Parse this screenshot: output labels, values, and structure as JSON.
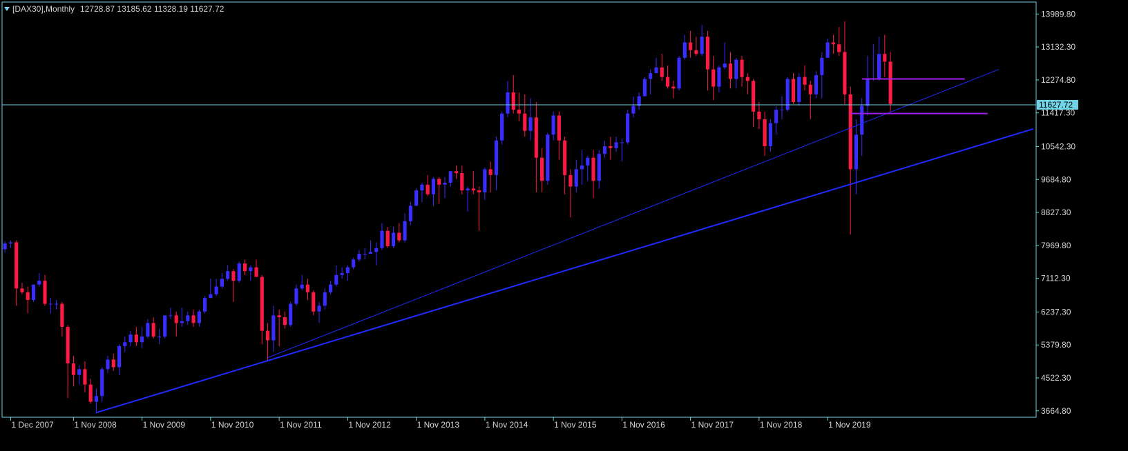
{
  "header": {
    "symbol": "[DAX30],Monthly",
    "ohlc": "12728.87 13185.62 11328.19 11627.72"
  },
  "colors": {
    "background": "#000000",
    "frame": "#6fd3e6",
    "bull": "#3a2dff",
    "bear": "#ff1a45",
    "bid_line": "#6fd3e6",
    "trendline": "#1f2bff",
    "level_line": "#a020f0",
    "axis_text": "#d8d8d8"
  },
  "chart_data": {
    "type": "candlestick",
    "timeframe": "Monthly",
    "symbol": "[DAX30]",
    "last_price": 11627.72,
    "last_price_label": "11627.72",
    "y_ticks": [
      "13989.80",
      "13132.30",
      "12274.80",
      "11417.30",
      "10542.30",
      "9684.80",
      "8827.30",
      "7969.80",
      "7112.30",
      "6237.30",
      "5379.80",
      "4522.30",
      "3664.80"
    ],
    "x_ticks": [
      "1 Dec 2007",
      "1 Nov 2008",
      "1 Nov 2009",
      "1 Nov 2010",
      "1 Nov 2011",
      "1 Nov 2012",
      "1 Nov 2013",
      "1 Nov 2014",
      "1 Nov 2015",
      "1 Nov 2016",
      "1 Nov 2017",
      "1 Nov 2018",
      "1 Nov 2019"
    ],
    "y_range": [
      3500,
      14300
    ],
    "x_start": "2007-11",
    "x_end": "2022-11",
    "candles": [
      [
        "2007-11",
        7870,
        8080,
        7780,
        8020
      ],
      [
        "2007-12",
        8020,
        8100,
        7900,
        8050
      ],
      [
        "2008-01",
        8050,
        8100,
        6400,
        6850
      ],
      [
        "2008-02",
        6850,
        7000,
        6700,
        6750
      ],
      [
        "2008-03",
        6750,
        6900,
        6200,
        6550
      ],
      [
        "2008-04",
        6550,
        6950,
        6500,
        6950
      ],
      [
        "2008-05",
        6950,
        7250,
        6900,
        7050
      ],
      [
        "2008-06",
        7050,
        7200,
        6400,
        6450
      ],
      [
        "2008-07",
        6450,
        6600,
        6200,
        6450
      ],
      [
        "2008-08",
        6450,
        6550,
        6300,
        6450
      ],
      [
        "2008-09",
        6450,
        6500,
        5600,
        5850
      ],
      [
        "2008-10",
        5850,
        5900,
        4000,
        4900
      ],
      [
        "2008-11",
        4900,
        5100,
        4300,
        4600
      ],
      [
        "2008-12",
        4600,
        4850,
        4350,
        4750
      ],
      [
        "2009-01",
        4750,
        4950,
        4150,
        4350
      ],
      [
        "2009-02",
        4350,
        4500,
        3850,
        3900
      ],
      [
        "2009-03",
        3900,
        4250,
        3600,
        4050
      ],
      [
        "2009-04",
        4050,
        4800,
        3900,
        4750
      ],
      [
        "2009-05",
        4750,
        5100,
        4650,
        5000
      ],
      [
        "2009-06",
        5000,
        5150,
        4700,
        4800
      ],
      [
        "2009-07",
        4800,
        5400,
        4600,
        5350
      ],
      [
        "2009-08",
        5350,
        5600,
        5200,
        5450
      ],
      [
        "2009-09",
        5450,
        5750,
        5350,
        5650
      ],
      [
        "2009-10",
        5650,
        5850,
        5350,
        5450
      ],
      [
        "2009-11",
        5450,
        5850,
        5300,
        5600
      ],
      [
        "2009-12",
        5600,
        6050,
        5550,
        5950
      ],
      [
        "2010-01",
        5950,
        6100,
        5550,
        5600
      ],
      [
        "2010-02",
        5600,
        5800,
        5400,
        5600
      ],
      [
        "2010-03",
        5600,
        6150,
        5550,
        6150
      ],
      [
        "2010-04",
        6150,
        6350,
        6050,
        6150
      ],
      [
        "2010-05",
        6150,
        6250,
        5600,
        5950
      ],
      [
        "2010-06",
        5950,
        6350,
        5850,
        6000
      ],
      [
        "2010-07",
        6000,
        6250,
        5900,
        6150
      ],
      [
        "2010-08",
        6150,
        6300,
        5850,
        5950
      ],
      [
        "2010-09",
        5950,
        6300,
        5850,
        6250
      ],
      [
        "2010-10",
        6250,
        6650,
        6200,
        6600
      ],
      [
        "2010-11",
        6600,
        7100,
        6600,
        6700
      ],
      [
        "2010-12",
        6700,
        7100,
        6650,
        6900
      ],
      [
        "2011-01",
        6900,
        7250,
        6850,
        7100
      ],
      [
        "2011-02",
        7100,
        7450,
        7050,
        7300
      ],
      [
        "2011-03",
        7300,
        7350,
        6500,
        7050
      ],
      [
        "2011-04",
        7050,
        7550,
        7000,
        7500
      ],
      [
        "2011-05",
        7500,
        7600,
        7200,
        7300
      ],
      [
        "2011-06",
        7300,
        7450,
        7050,
        7400
      ],
      [
        "2011-07",
        7400,
        7600,
        7200,
        7150
      ],
      [
        "2011-08",
        7150,
        7200,
        5400,
        5750
      ],
      [
        "2011-09",
        5750,
        5950,
        4950,
        5500
      ],
      [
        "2011-10",
        5500,
        6400,
        5200,
        6150
      ],
      [
        "2011-11",
        6150,
        6300,
        5350,
        6100
      ],
      [
        "2011-12",
        6100,
        6250,
        5800,
        5900
      ],
      [
        "2012-01",
        5900,
        6500,
        5850,
        6450
      ],
      [
        "2012-02",
        6450,
        6950,
        6400,
        6850
      ],
      [
        "2012-03",
        6850,
        7200,
        6800,
        6950
      ],
      [
        "2012-04",
        6950,
        7100,
        6550,
        6750
      ],
      [
        "2012-05",
        6750,
        6800,
        6150,
        6250
      ],
      [
        "2012-06",
        6250,
        6500,
        5950,
        6400
      ],
      [
        "2012-07",
        6400,
        6850,
        6300,
        6750
      ],
      [
        "2012-08",
        6750,
        7050,
        6700,
        6950
      ],
      [
        "2012-09",
        6950,
        7450,
        6900,
        7200
      ],
      [
        "2012-10",
        7200,
        7400,
        7100,
        7250
      ],
      [
        "2012-11",
        7250,
        7450,
        7050,
        7400
      ],
      [
        "2012-12",
        7400,
        7650,
        7350,
        7600
      ],
      [
        "2013-01",
        7600,
        7850,
        7550,
        7750
      ],
      [
        "2013-02",
        7750,
        7900,
        7600,
        7750
      ],
      [
        "2013-03",
        7750,
        8100,
        7750,
        7800
      ],
      [
        "2013-04",
        7800,
        8050,
        7450,
        7900
      ],
      [
        "2013-05",
        7900,
        8550,
        7850,
        8350
      ],
      [
        "2013-06",
        8350,
        8450,
        7900,
        7950
      ],
      [
        "2013-07",
        7950,
        8450,
        7900,
        8300
      ],
      [
        "2013-08",
        8300,
        8550,
        8050,
        8100
      ],
      [
        "2013-09",
        8100,
        8800,
        8050,
        8600
      ],
      [
        "2013-10",
        8600,
        9100,
        8500,
        9000
      ],
      [
        "2013-11",
        9000,
        9450,
        9000,
        9400
      ],
      [
        "2013-12",
        9400,
        9600,
        9100,
        9550
      ],
      [
        "2014-01",
        9550,
        9800,
        9250,
        9300
      ],
      [
        "2014-02",
        9300,
        9750,
        9000,
        9700
      ],
      [
        "2014-03",
        9700,
        9750,
        9050,
        9550
      ],
      [
        "2014-04",
        9550,
        9750,
        9200,
        9600
      ],
      [
        "2014-05",
        9600,
        9900,
        9500,
        9900
      ],
      [
        "2014-06",
        9900,
        10050,
        9700,
        9850
      ],
      [
        "2014-07",
        9850,
        10050,
        9300,
        9400
      ],
      [
        "2014-08",
        9400,
        9500,
        8850,
        9450
      ],
      [
        "2014-09",
        9450,
        9900,
        9300,
        9400
      ],
      [
        "2014-10",
        9400,
        9500,
        8350,
        9350
      ],
      [
        "2014-11",
        9350,
        10000,
        9150,
        9950
      ],
      [
        "2014-12",
        9950,
        10150,
        9350,
        9800
      ],
      [
        "2015-01",
        9800,
        10800,
        9400,
        10700
      ],
      [
        "2015-02",
        10700,
        11450,
        10600,
        11400
      ],
      [
        "2015-03",
        11400,
        12250,
        11300,
        11950
      ],
      [
        "2015-04",
        11950,
        12400,
        11400,
        11500
      ],
      [
        "2015-05",
        11500,
        11950,
        11200,
        11400
      ],
      [
        "2015-06",
        11400,
        11900,
        10800,
        10950
      ],
      [
        "2015-07",
        10950,
        11800,
        10700,
        11300
      ],
      [
        "2015-08",
        11300,
        11700,
        9350,
        10250
      ],
      [
        "2015-09",
        10250,
        10500,
        9350,
        9650
      ],
      [
        "2015-10",
        9650,
        10900,
        9550,
        10850
      ],
      [
        "2015-11",
        10850,
        11450,
        10700,
        11350
      ],
      [
        "2015-12",
        11350,
        11450,
        10200,
        10700
      ],
      [
        "2016-01",
        10700,
        10800,
        9300,
        9800
      ],
      [
        "2016-02",
        9800,
        9950,
        8700,
        9500
      ],
      [
        "2016-03",
        9500,
        10200,
        9350,
        9950
      ],
      [
        "2016-04",
        9950,
        10450,
        9550,
        10050
      ],
      [
        "2016-05",
        10050,
        10300,
        9650,
        10250
      ],
      [
        "2016-06",
        10250,
        10450,
        9200,
        9650
      ],
      [
        "2016-07",
        9650,
        10450,
        9450,
        10350
      ],
      [
        "2016-08",
        10350,
        10700,
        10250,
        10550
      ],
      [
        "2016-09",
        10550,
        10800,
        10200,
        10500
      ],
      [
        "2016-10",
        10500,
        10800,
        10400,
        10650
      ],
      [
        "2016-11",
        10650,
        10750,
        10150,
        10650
      ],
      [
        "2016-12",
        10650,
        11500,
        10600,
        11400
      ],
      [
        "2017-01",
        11400,
        11850,
        11300,
        11600
      ],
      [
        "2017-02",
        11600,
        11950,
        11500,
        11850
      ],
      [
        "2017-03",
        11850,
        12350,
        11850,
        12300
      ],
      [
        "2017-04",
        12300,
        12550,
        11900,
        12450
      ],
      [
        "2017-05",
        12450,
        12850,
        12450,
        12600
      ],
      [
        "2017-06",
        12600,
        12950,
        12250,
        12350
      ],
      [
        "2017-07",
        12350,
        12650,
        12050,
        12100
      ],
      [
        "2017-08",
        12100,
        12250,
        11800,
        12050
      ],
      [
        "2017-09",
        12050,
        12900,
        12000,
        12850
      ],
      [
        "2017-10",
        12850,
        13450,
        12800,
        13250
      ],
      [
        "2017-11",
        13250,
        13550,
        12850,
        13050
      ],
      [
        "2017-12",
        13050,
        13400,
        12900,
        12950
      ],
      [
        "2018-01",
        12950,
        13700,
        12900,
        13400
      ],
      [
        "2018-02",
        13400,
        13550,
        12000,
        12550
      ],
      [
        "2018-03",
        12550,
        12900,
        11750,
        12100
      ],
      [
        "2018-04",
        12100,
        12650,
        11950,
        12600
      ],
      [
        "2018-05",
        12600,
        13250,
        12550,
        12700
      ],
      [
        "2018-06",
        12700,
        13000,
        12050,
        12300
      ],
      [
        "2018-07",
        12300,
        12850,
        12050,
        12800
      ],
      [
        "2018-08",
        12800,
        12900,
        12100,
        12350
      ],
      [
        "2018-09",
        12350,
        12450,
        11900,
        12250
      ],
      [
        "2018-10",
        12250,
        12300,
        11050,
        11450
      ],
      [
        "2018-11",
        11450,
        11700,
        11000,
        11250
      ],
      [
        "2018-12",
        11250,
        11450,
        10300,
        10550
      ],
      [
        "2019-01",
        10550,
        11250,
        10400,
        11150
      ],
      [
        "2019-02",
        11150,
        11600,
        10850,
        11500
      ],
      [
        "2019-03",
        11500,
        11850,
        11250,
        11500
      ],
      [
        "2019-04",
        11500,
        12350,
        11450,
        12300
      ],
      [
        "2019-05",
        12300,
        12450,
        11650,
        11700
      ],
      [
        "2019-06",
        11700,
        12450,
        11600,
        12350
      ],
      [
        "2019-07",
        12350,
        12650,
        12000,
        12150
      ],
      [
        "2019-08",
        12150,
        12250,
        11250,
        11900
      ],
      [
        "2019-09",
        11900,
        12500,
        11800,
        12400
      ],
      [
        "2019-10",
        12400,
        13000,
        11800,
        12850
      ],
      [
        "2019-11",
        12850,
        13350,
        12850,
        13250
      ],
      [
        "2019-12",
        13250,
        13450,
        12950,
        13200
      ],
      [
        "2020-01",
        13200,
        13650,
        12900,
        13000
      ],
      [
        "2020-02",
        13000,
        13800,
        11650,
        11900
      ],
      [
        "2020-03",
        11900,
        12100,
        8250,
        9950
      ],
      [
        "2020-04",
        9950,
        11250,
        9300,
        10850
      ],
      [
        "2020-05",
        10850,
        11800,
        10300,
        11600
      ],
      [
        "2020-06",
        11600,
        12900,
        11350,
        12300
      ],
      [
        "2020-07",
        12300,
        13200,
        12250,
        12300
      ],
      [
        "2020-08",
        12300,
        13400,
        12250,
        12950
      ],
      [
        "2020-09",
        12950,
        13450,
        12350,
        12750
      ],
      [
        "2020-10",
        12750,
        13000,
        11450,
        11650
      ]
    ],
    "trendlines": [
      {
        "name": "major-support",
        "from": [
          "2009-03",
          3620
        ],
        "to": [
          "2022-11",
          11000
        ],
        "width": 2
      },
      {
        "name": "minor-support",
        "from": [
          "2011-09",
          5050
        ],
        "to": [
          "2022-05",
          12550
        ],
        "width": 1
      }
    ],
    "levels": [
      {
        "name": "upper-level",
        "from": "2020-05",
        "to": "2021-11",
        "price": 12300
      },
      {
        "name": "lower-level",
        "from": "2020-03",
        "to": "2022-03",
        "price": 11400
      }
    ]
  }
}
